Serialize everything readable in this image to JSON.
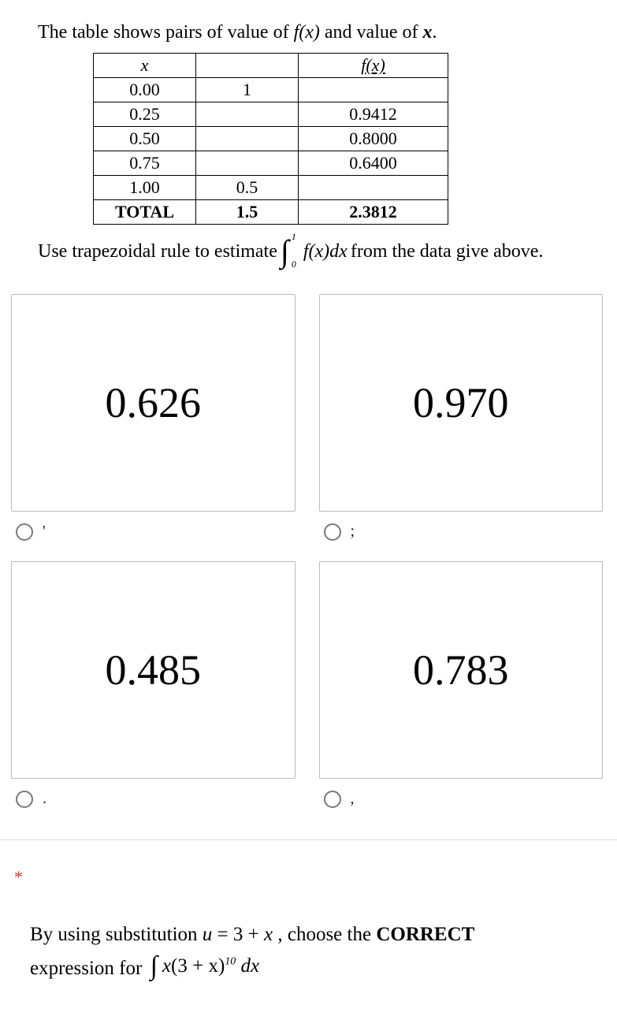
{
  "question1": {
    "intro_pre": "The table shows pairs of value of ",
    "intro_fx": "f(x)",
    "intro_mid": " and value of ",
    "intro_x": "x",
    "intro_end": ".",
    "table": {
      "header_x": "x",
      "header_fx": "f(x)",
      "rows": [
        {
          "x": "0.00",
          "mid": "1",
          "fx": ""
        },
        {
          "x": "0.25",
          "mid": "",
          "fx": "0.9412"
        },
        {
          "x": "0.50",
          "mid": "",
          "fx": "0.8000"
        },
        {
          "x": "0.75",
          "mid": "",
          "fx": "0.6400"
        },
        {
          "x": "1.00",
          "mid": "0.5",
          "fx": ""
        }
      ],
      "total_label": "TOTAL",
      "total_mid": "1.5",
      "total_fx": "2.3812"
    },
    "instruction_pre": "Use trapezoidal rule to estimate ",
    "integral_upper": "1",
    "integral_lower": "0",
    "integral_body_f": "f",
    "integral_body_x": "(x)",
    "integral_body_dx": "dx",
    "instruction_post": " from the data give above.",
    "options": [
      {
        "value": "0.626",
        "label": "'"
      },
      {
        "value": "0.970",
        "label": ";"
      },
      {
        "value": "0.485",
        "label": "."
      },
      {
        "value": "0.783",
        "label": ","
      }
    ]
  },
  "question2": {
    "required": "*",
    "line1_pre": "By using substitution ",
    "line1_u": "u",
    "line1_eq": " = 3 + ",
    "line1_x": "x",
    "line1_mid": " , choose the ",
    "line1_correct": "CORRECT",
    "line2_pre": "expression for ",
    "int2_body_x": "x",
    "int2_body_paren": "(3 + x)",
    "int2_exp": "10",
    "int2_dx": " dx"
  }
}
